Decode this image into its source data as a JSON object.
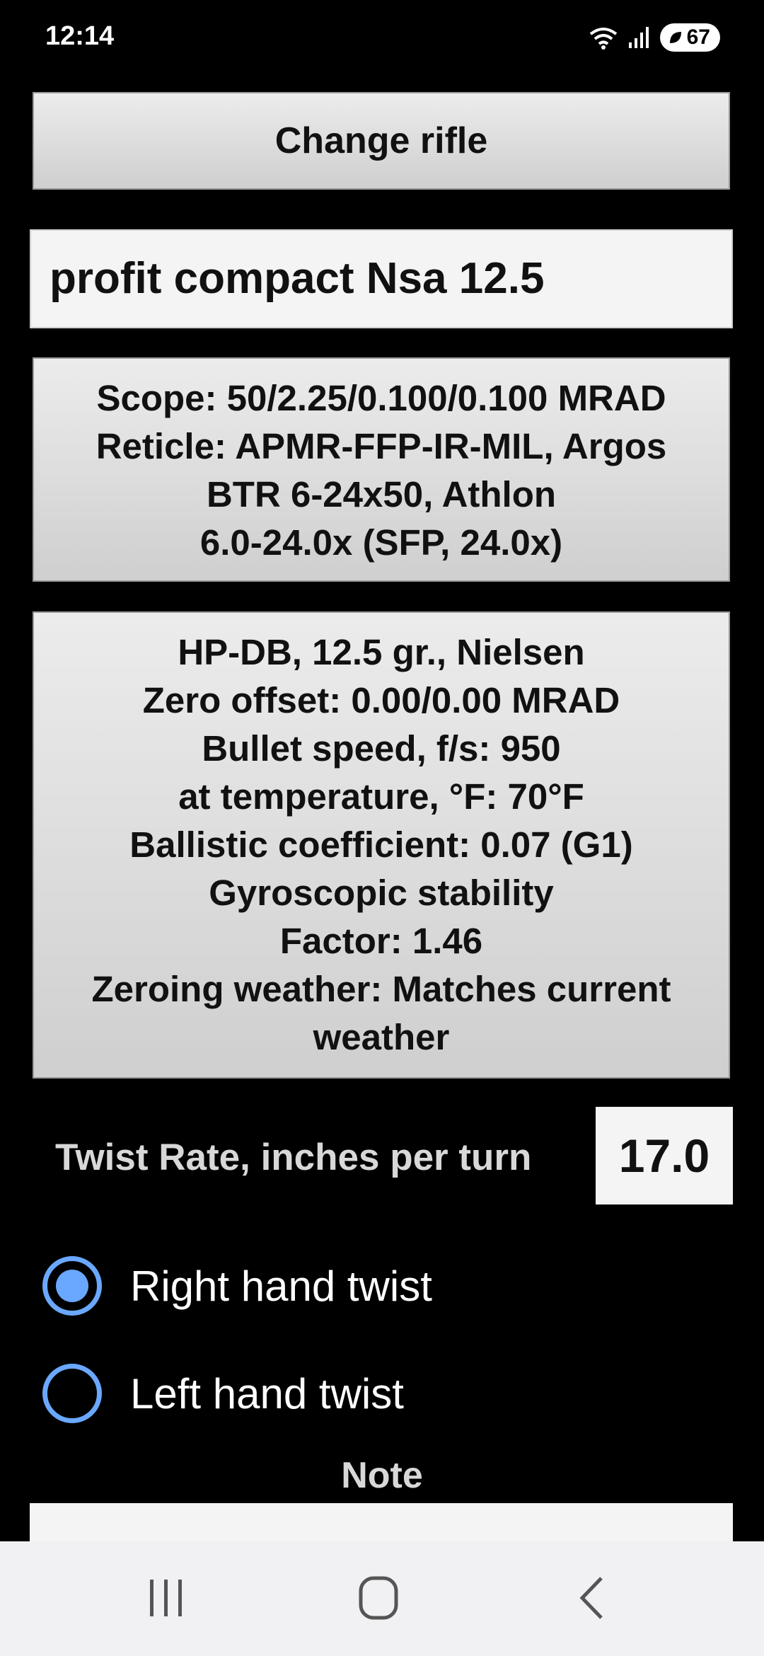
{
  "status": {
    "time": "12:14",
    "battery": "67"
  },
  "change_rifle_label": "Change rifle",
  "rifle_name": "profit compact Nsa 12.5",
  "scope": {
    "lines": [
      "Scope: 50/2.25/0.100/0.100 MRAD",
      "Reticle: APMR-FFP-IR-MIL, Argos",
      "BTR 6-24x50, Athlon",
      "6.0-24.0x (SFP, 24.0x)"
    ]
  },
  "bullet": {
    "lines": [
      "HP-DB, 12.5 gr., Nielsen",
      "Zero offset: 0.00/0.00 MRAD",
      "Bullet speed, f/s: 950",
      "at temperature, °F: 70°F",
      "Ballistic coefficient: 0.07 (G1)",
      "Gyroscopic stability",
      "Factor: 1.46",
      "Zeroing weather: Matches current",
      "weather"
    ]
  },
  "twist": {
    "label": "Twist Rate, inches per turn",
    "value": "17.0"
  },
  "twist_direction": {
    "right_label": "Right hand twist",
    "left_label": "Left hand twist",
    "selected": "right"
  },
  "note_label": "Note",
  "colors": {
    "accent": "#6aa8ff",
    "background": "#000000",
    "button": "#dcdcdc"
  },
  "icons": {
    "wifi": "wifi-icon",
    "signal": "signal-icon",
    "battery": "battery-leaf-icon",
    "recents": "recents-icon",
    "home": "home-icon",
    "back": "back-icon"
  }
}
